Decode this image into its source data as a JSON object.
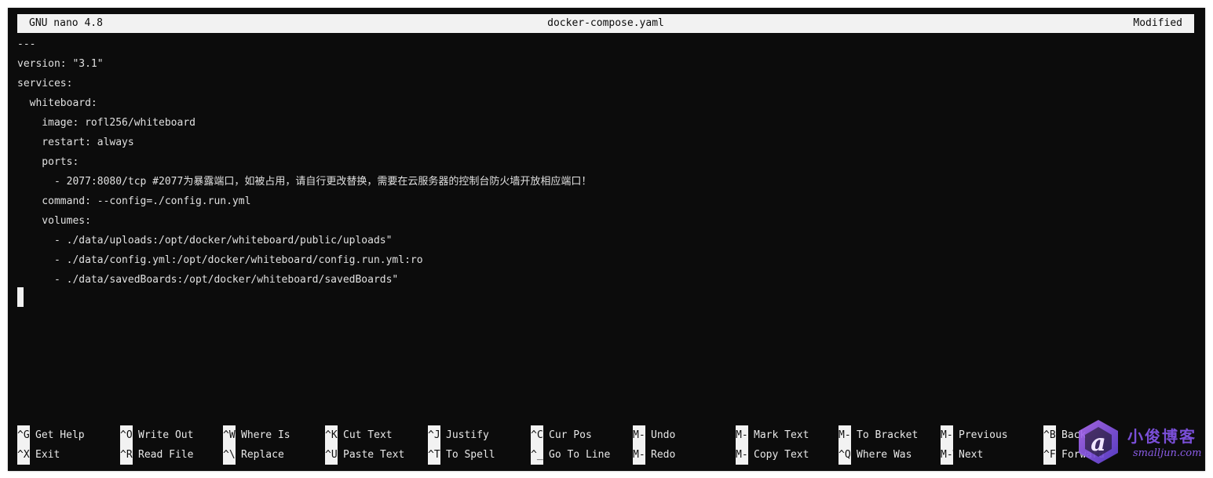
{
  "titlebar": {
    "app": "GNU nano 4.8",
    "filename": "docker-compose.yaml",
    "status": "Modified"
  },
  "editor": {
    "lines": [
      "---",
      "version: \"3.1\"",
      "services:",
      "  whiteboard:",
      "    image: rofl256/whiteboard",
      "    restart: always",
      "    ports:",
      "      - 2077:8080/tcp #2077为暴露端口，如被占用，请自行更改替换，需要在云服务器的控制台防火墙开放相应端口！",
      "    command: --config=./config.run.yml",
      "    volumes:",
      "      - ./data/uploads:/opt/docker/whiteboard/public/uploads\"",
      "      - ./data/config.yml:/opt/docker/whiteboard/config.run.yml:ro",
      "      - ./data/savedBoards:/opt/docker/whiteboard/savedBoards\""
    ]
  },
  "shortcuts": {
    "row1": [
      {
        "key": "^G",
        "label": "Get Help"
      },
      {
        "key": "^O",
        "label": "Write Out"
      },
      {
        "key": "^W",
        "label": "Where Is"
      },
      {
        "key": "^K",
        "label": "Cut Text"
      },
      {
        "key": "^J",
        "label": "Justify"
      },
      {
        "key": "^C",
        "label": "Cur Pos"
      },
      {
        "key": "M-U",
        "label": "Undo"
      },
      {
        "key": "M-A",
        "label": "Mark Text"
      },
      {
        "key": "M-]",
        "label": "To Bracket"
      },
      {
        "key": "M-Q",
        "label": "Previous"
      },
      {
        "key": "^B",
        "label": "Back"
      }
    ],
    "row2": [
      {
        "key": "^X",
        "label": "Exit"
      },
      {
        "key": "^R",
        "label": "Read File"
      },
      {
        "key": "^\\",
        "label": "Replace"
      },
      {
        "key": "^U",
        "label": "Paste Text"
      },
      {
        "key": "^T",
        "label": "To Spell"
      },
      {
        "key": "^_",
        "label": "Go To Line"
      },
      {
        "key": "M-E",
        "label": "Redo"
      },
      {
        "key": "M-6",
        "label": "Copy Text"
      },
      {
        "key": "^Q",
        "label": "Where Was"
      },
      {
        "key": "M-W",
        "label": "Next"
      },
      {
        "key": "^F",
        "label": "Forward"
      }
    ]
  },
  "watermark": {
    "cn": "小俊博客",
    "en": "smalljun.com"
  },
  "colors": {
    "terminal_bg": "#0c0c0c",
    "text": "#d8d8d8",
    "bar_bg": "#f2f2f2",
    "watermark_purple": "#7a4fd8"
  }
}
